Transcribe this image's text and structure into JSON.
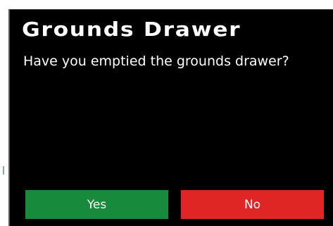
{
  "dialog": {
    "title": "Grounds Drawer",
    "message": "Have you emptied the grounds drawer?",
    "buttons": {
      "yes_label": "Yes",
      "no_label": "No"
    }
  },
  "colors": {
    "background": "#000000",
    "text": "#ffffff",
    "yes_button": "#178a3c",
    "no_button": "#e02525"
  }
}
